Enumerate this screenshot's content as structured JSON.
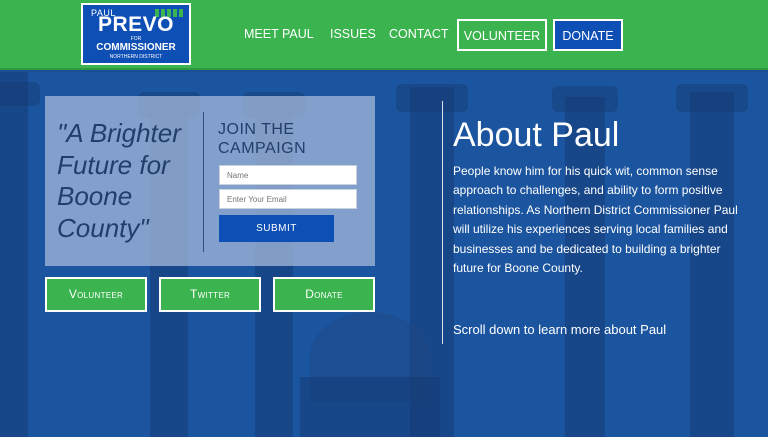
{
  "logo": {
    "first_name": "PAUL",
    "last_name": "PREVO",
    "for": "FOR",
    "title": "COMMISSIONER",
    "district": "NORTHERN DISTRICT"
  },
  "nav": {
    "links": [
      "MEET PAUL",
      "ISSUES",
      "CONTACT"
    ],
    "volunteer": "VOLUNTEER",
    "donate": "DONATE"
  },
  "panel": {
    "quote": "\"A Brighter Future for Boone County\"",
    "join": "JOIN THE CAMPAIGN",
    "name_placeholder": "Name",
    "email_placeholder": "Enter Your Email",
    "submit": "SUBMIT"
  },
  "buttons": {
    "volunteer": "Volunteer",
    "twitter": "Twitter",
    "donate": "Donate"
  },
  "about": {
    "title": "About Paul",
    "body": "People know him for his quick wit, common sense approach to challenges, and ability to form positive relationships. As Northern District Commissioner Paul will utilize his experiences serving local families and businesses and be dedicated to building a brighter future for Boone County.",
    "scroll": "Scroll down to learn more about Paul"
  },
  "colors": {
    "header_green": "#3bb44f",
    "brand_blue": "#0e4fb5",
    "hero_blue": "#1c559f"
  }
}
